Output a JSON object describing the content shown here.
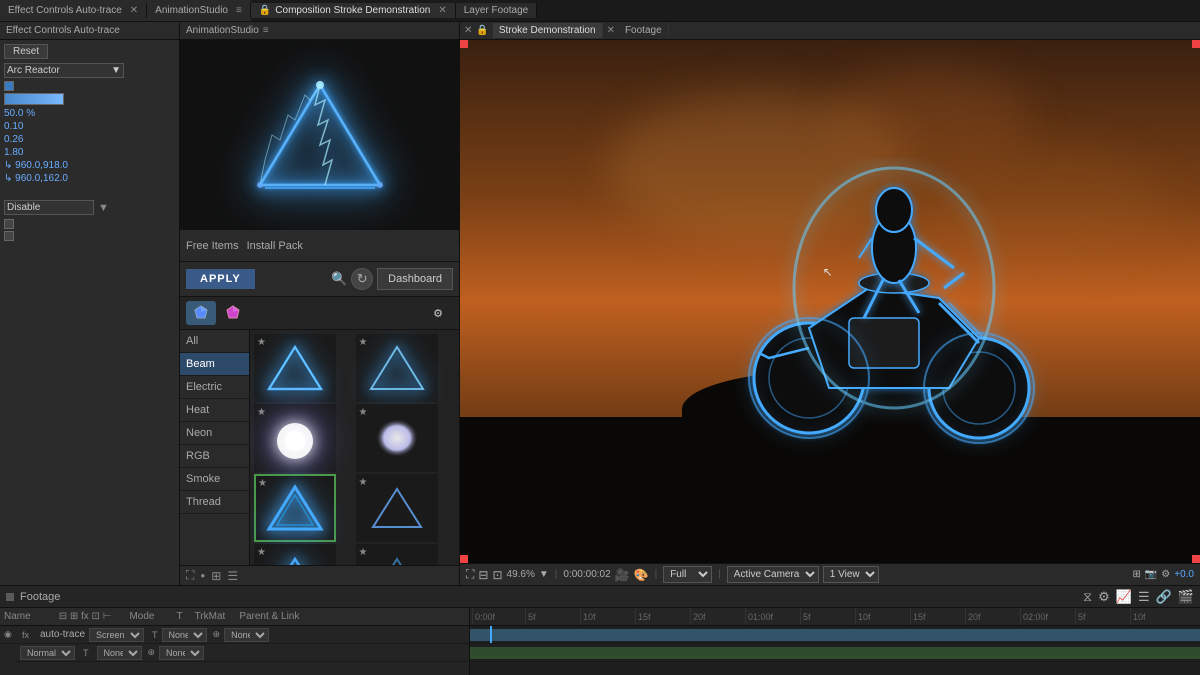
{
  "topBar": {
    "effectControls": "Effect Controls  Auto-trace",
    "animationStudio": "AnimationStudio",
    "composition": "Composition Stroke Demonstration",
    "layerFootage": "Layer Footage"
  },
  "effectControls": {
    "resetLabel": "Reset",
    "presetLabel": "Arc Reactor",
    "values": [
      "50.0 %",
      "0.10",
      "0.26",
      "1.80",
      "↳ 960.0,918.0",
      "↳ 960.0,162.0"
    ],
    "disableLabel": "Disable"
  },
  "animationStudio": {
    "freeItemsLabel": "Free Items",
    "installPackLabel": "Install Pack",
    "applyLabel": "APPLY",
    "dashboardLabel": "Dashboard",
    "categories": [
      "All",
      "Beam",
      "Electric",
      "Heat",
      "Neon",
      "RGB",
      "Smoke",
      "Thread"
    ]
  },
  "composition": {
    "tabs": [
      "Stroke Demonstration",
      "Footage"
    ],
    "zoomLevel": "49.6%",
    "timecode": "0:00:00:02",
    "viewMode": "Full",
    "cameraMode": "Active Camera",
    "viewCount": "1 View"
  },
  "timeline": {
    "footage": "Footage",
    "layerName": "auto-trace",
    "blendMode": "Screen",
    "trkMat": "None",
    "parentLink": "None",
    "markers": [
      "0:00f",
      "5f",
      "10f",
      "15f",
      "20f",
      "01:00f",
      "5f",
      "10f",
      "15f",
      "20f",
      "02:00f",
      "5f",
      "10f"
    ]
  }
}
